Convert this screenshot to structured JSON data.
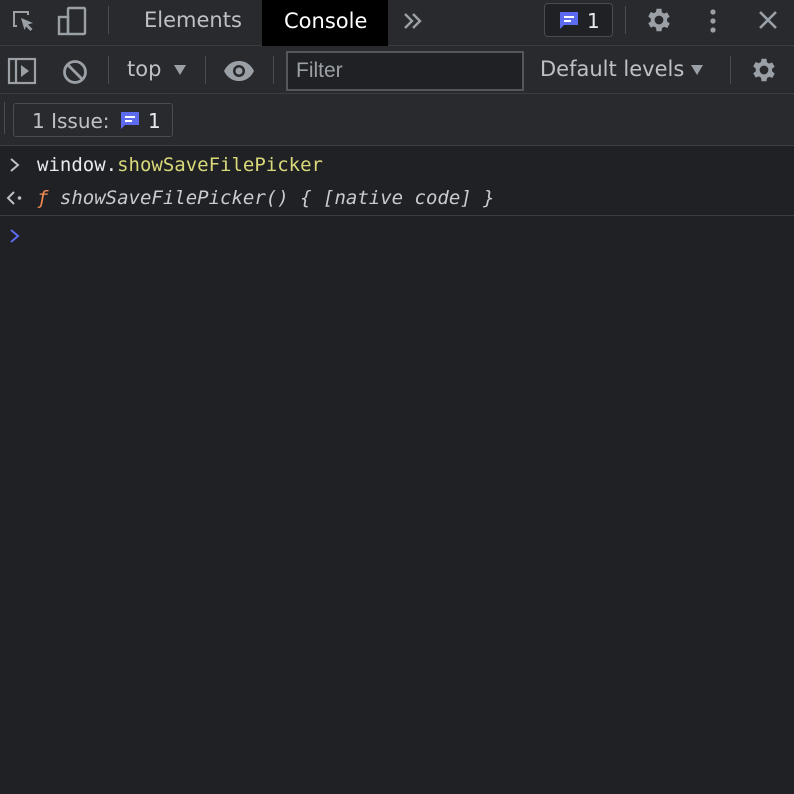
{
  "toolbar": {
    "tabs": [
      {
        "label": "Elements"
      },
      {
        "label": "Console"
      }
    ],
    "issues_badge_count": "1"
  },
  "console_toolbar": {
    "context": "top",
    "filter": {
      "value": "",
      "placeholder": "Filter"
    },
    "levels": "Default levels"
  },
  "issues_bar": {
    "label": "1 Issue:",
    "count": "1"
  },
  "console": {
    "input": {
      "object": "window.",
      "property": "showSaveFilePicker"
    },
    "result": {
      "f": "ƒ",
      "text": "showSaveFilePicker() { [native code] }"
    }
  },
  "colors": {
    "background": "#202124",
    "toolbar": "#292a2d",
    "accent_blue": "#5c6bf0",
    "property_yellow": "#d9d97a",
    "function_orange": "#f28b54"
  },
  "icons": [
    "inspect-icon",
    "device-toggle-icon",
    "more-tabs-icon",
    "issues-icon",
    "settings-icon",
    "kebab-menu-icon",
    "close-icon",
    "sidebar-toggle-icon",
    "clear-console-icon",
    "dropdown-arrow-icon",
    "live-expression-eye-icon",
    "console-settings-icon",
    "input-chevron-icon",
    "result-arrow-icon",
    "prompt-chevron-icon"
  ]
}
